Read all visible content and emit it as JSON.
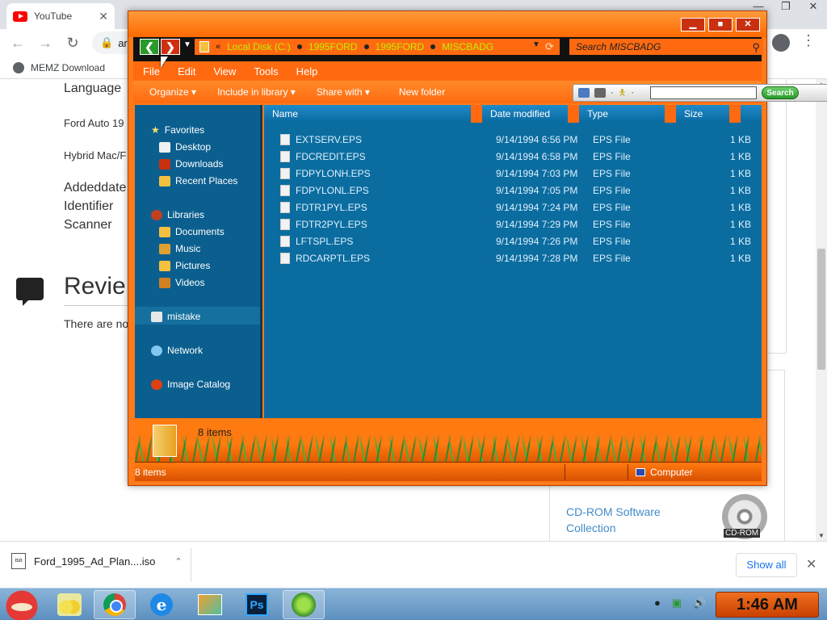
{
  "browser": {
    "tab_title": "YouTube",
    "address_text": "arc",
    "bookmark_label": "MEMZ Download"
  },
  "page": {
    "meta_labels": [
      "Language",
      "Ford Auto 19",
      "Hybrid Mac/F",
      "Addeddate",
      "Identifier",
      "Scanner"
    ],
    "reviews_title": "Revie",
    "reviews_empty": "There are no",
    "collection_link": "CD-ROM Software Collection",
    "cd_label": "CD-ROM"
  },
  "downloads": {
    "filename": "Ford_1995_Ad_Plan....iso",
    "file_icon_label": "iso",
    "show_all_label": "Show all"
  },
  "explorer": {
    "breadcrumb": [
      "Local Disk (C:)",
      "1995FORD",
      "1995FORD",
      "MISCBADG"
    ],
    "search_placeholder": "Search MISCBADG",
    "menu": [
      "File",
      "Edit",
      "View",
      "Tools",
      "Help"
    ],
    "commands": [
      "Organize",
      "Include in library",
      "Share with",
      "New folder"
    ],
    "ie_toolbar_search_label": "Search",
    "nav": {
      "favorites": "Favorites",
      "favorites_items": [
        "Desktop",
        "Downloads",
        "Recent Places"
      ],
      "libraries": "Libraries",
      "libraries_items": [
        "Documents",
        "Music",
        "Pictures",
        "Videos"
      ],
      "user": "mistake",
      "network": "Network",
      "image_catalog": "Image Catalog"
    },
    "columns": [
      "Name",
      "Date modified",
      "Type",
      "Size"
    ],
    "files": [
      {
        "name": "EXTSERV.EPS",
        "date": "9/14/1994 6:56 PM",
        "type": "EPS File",
        "size": "1 KB"
      },
      {
        "name": "FDCREDIT.EPS",
        "date": "9/14/1994 6:58 PM",
        "type": "EPS File",
        "size": "1 KB"
      },
      {
        "name": "FDPYLONH.EPS",
        "date": "9/14/1994 7:03 PM",
        "type": "EPS File",
        "size": "1 KB"
      },
      {
        "name": "FDPYLONL.EPS",
        "date": "9/14/1994 7:05 PM",
        "type": "EPS File",
        "size": "1 KB"
      },
      {
        "name": "FDTR1PYL.EPS",
        "date": "9/14/1994 7:24 PM",
        "type": "EPS File",
        "size": "1 KB"
      },
      {
        "name": "FDTR2PYL.EPS",
        "date": "9/14/1994 7:29 PM",
        "type": "EPS File",
        "size": "1 KB"
      },
      {
        "name": "LFTSPL.EPS",
        "date": "9/14/1994 7:26 PM",
        "type": "EPS File",
        "size": "1 KB"
      },
      {
        "name": "RDCARPTL.EPS",
        "date": "9/14/1994 7:28 PM",
        "type": "EPS File",
        "size": "1 KB"
      }
    ],
    "details_count": "8 items",
    "status_count": "8 items",
    "status_location": "Computer"
  },
  "taskbar": {
    "ps_label": "Ps",
    "ie_label": "e",
    "clock": "1:46 AM"
  },
  "colors": {
    "explorer_skin": "#ff7a1a",
    "pane_blue": "#0b6d9f",
    "breadcrumb_text": "#c0f000"
  }
}
